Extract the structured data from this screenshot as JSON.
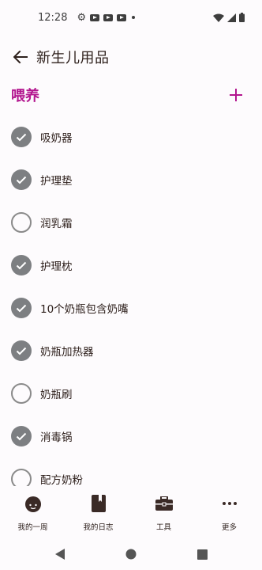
{
  "status_bar": {
    "time": "12:28",
    "icons": [
      "gear-icon",
      "youtube-icon",
      "youtube-icon",
      "youtube-icon",
      "dot-icon"
    ],
    "right_icons": [
      "wifi-icon",
      "signal-icon",
      "battery-icon"
    ]
  },
  "app_bar": {
    "title": "新生儿用品"
  },
  "section": {
    "title": "喂养",
    "accent_color": "#b3168f"
  },
  "items": [
    {
      "label": "吸奶器",
      "checked": true
    },
    {
      "label": "护理垫",
      "checked": true
    },
    {
      "label": "润乳霜",
      "checked": false
    },
    {
      "label": "护理枕",
      "checked": true
    },
    {
      "label": "10个奶瓶包含奶嘴",
      "checked": true
    },
    {
      "label": "奶瓶加热器",
      "checked": true
    },
    {
      "label": "奶瓶刷",
      "checked": false
    },
    {
      "label": "消毒锅",
      "checked": true
    },
    {
      "label": "配方奶粉",
      "checked": false
    }
  ],
  "bottom_nav": [
    {
      "label": "我的一周",
      "icon": "baby-face-icon"
    },
    {
      "label": "我的日志",
      "icon": "journal-icon"
    },
    {
      "label": "工具",
      "icon": "toolbox-icon"
    },
    {
      "label": "更多",
      "icon": "more-dots-icon"
    }
  ],
  "system_nav": [
    "back-triangle-icon",
    "home-circle-icon",
    "recents-square-icon"
  ]
}
